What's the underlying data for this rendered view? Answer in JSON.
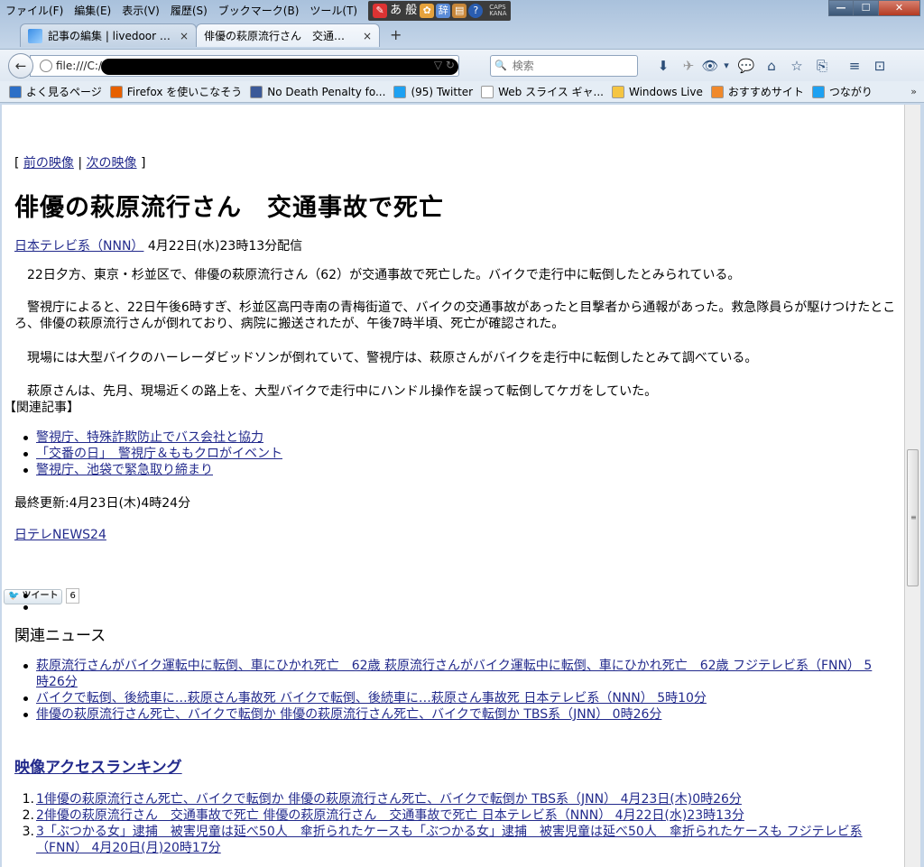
{
  "menu": [
    "ファイル(F)",
    "編集(E)",
    "表示(V)",
    "履歴(S)",
    "ブックマーク(B)",
    "ツール(T)"
  ],
  "addons": {
    "ime_text": "あ 般",
    "caps": "CAPS",
    "kana": "KANA"
  },
  "window_controls": {
    "minimize": "—",
    "maximize": "☐",
    "close": "✕"
  },
  "tabs": [
    {
      "label": "記事の編集 | livedoor Blog",
      "close": "×",
      "active": false
    },
    {
      "label": "俳優の萩原流行さん　交通事...",
      "close": "×",
      "active": true
    }
  ],
  "new_tab": "+",
  "nav": {
    "back": "←",
    "url": "file:///C:/U",
    "url_buttons": "▽ ↻",
    "search_placeholder": "検索",
    "search_icon": "🔍",
    "toolbar_icons": [
      "⬇",
      "✈",
      "👁",
      "▾",
      "💬",
      "⌂",
      "☆",
      "⎘",
      "≡",
      "⊡"
    ]
  },
  "bookmarks": [
    {
      "label": "よく見るページ",
      "color": "#2c6fc7"
    },
    {
      "label": "Firefox を使いこなそう",
      "color": "#e66000"
    },
    {
      "label": "No Death Penalty fo...",
      "color": "#3b5998"
    },
    {
      "label": "(95) Twitter",
      "color": "#1da1f2"
    },
    {
      "label": "Web スライス ギャ...",
      "color": "#ffffff"
    },
    {
      "label": "Windows Live",
      "color": "#f5c542"
    },
    {
      "label": "おすすめサイト",
      "color": "#f0892c"
    },
    {
      "label": "つながり",
      "color": "#1da1f2"
    }
  ],
  "bookmarks_more": "»",
  "article": {
    "nav_open": "[",
    "prev": "前の映像",
    "sep": "|",
    "next": "次の映像",
    "nav_close": "]",
    "title": "俳優の萩原流行さん　交通事故で死亡",
    "source_link": "日本テレビ系（NNN）",
    "date": " 4月22日(水)23時13分配信",
    "paragraphs": [
      "　22日夕方、東京・杉並区で、俳優の萩原流行さん（62）が交通事故で死亡した。バイクで走行中に転倒したとみられている。",
      "　警視庁によると、22日午後6時すぎ、杉並区高円寺南の青梅街道で、バイクの交通事故があったと目撃者から通報があった。救急隊員らが駆けつけたところ、俳優の萩原流行さんが倒れており、病院に搬送されたが、午後7時半頃、死亡が確認された。",
      "　現場には大型バイクのハーレーダビッドソンが倒れていて、警視庁は、萩原さんがバイクを走行中に転倒したとみて調べている。",
      "　萩原さんは、先月、現場近くの路上を、大型バイクで走行中にハンドル操作を誤って転倒してケガをしていた。"
    ],
    "related_label": "【関連記事】",
    "related": [
      "警視庁、特殊詐欺防止でバス会社と協力",
      "「交番の日」　警視庁＆ももクロがイベント",
      "警視庁、池袋で緊急取り締まり"
    ],
    "updated": "最終更新:4月23日(木)4時24分",
    "news24": "日テレNEWS24",
    "tweet_label": "ツイート",
    "tweet_count": "6"
  },
  "related_news": {
    "heading": "関連ニュース",
    "items": [
      [
        "萩原流行さんがバイク運転中に転倒、車にひかれ死亡　62歳 萩原流行さんがバイク運転中に転倒、車にひかれ死亡　62歳 フジテレビ系（FNN） 5",
        "時26分"
      ],
      [
        "バイクで転倒、後続車に…萩原さん事故死 バイクで転倒、後続車に…萩原さん事故死 日本テレビ系（NNN） 5時10分"
      ],
      [
        "俳優の萩原流行さん死亡、バイクで転倒か 俳優の萩原流行さん死亡、バイクで転倒か TBS系（JNN） 0時26分"
      ]
    ]
  },
  "ranking": {
    "heading": "映像アクセスランキング",
    "items": [
      {
        "num": "1.",
        "lines": [
          "1俳優の萩原流行さん死亡、バイクで転倒か 俳優の萩原流行さん死亡、バイクで転倒か TBS系（JNN） 4月23日(木)0時26分"
        ]
      },
      {
        "num": "2.",
        "lines": [
          "2俳優の萩原流行さん　交通事故で死亡 俳優の萩原流行さん　交通事故で死亡 日本テレビ系（NNN） 4月22日(水)23時13分"
        ]
      },
      {
        "num": "3.",
        "lines": [
          "3「ぶつかる女」逮捕　被害児童は延べ50人　傘折られたケースも「ぶつかる女」逮捕　被害児童は延べ50人　傘折られたケースも フジテレビ系",
          "（FNN） 4月20日(月)20時17分"
        ]
      }
    ]
  }
}
